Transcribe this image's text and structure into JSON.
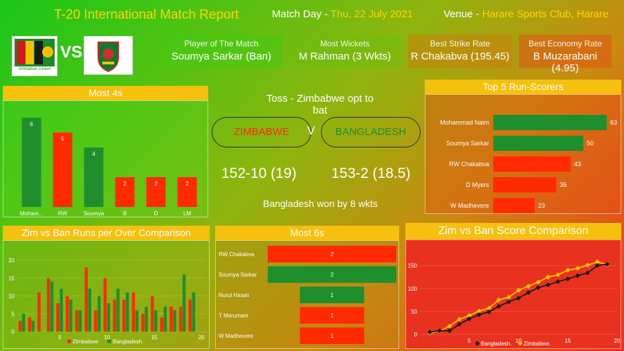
{
  "header": {
    "title": "T-20 International Match Report",
    "match_day_label": "Match Day - ",
    "match_day_value": "Thu, 22 July 2021",
    "venue_label": "Venue - ",
    "venue_value": "Harare Sports Club, Harare"
  },
  "logos": {
    "zimbabwe_caption": "zimbabwe cricket",
    "vs": "VS"
  },
  "kpis": [
    {
      "label": "Player of The Match",
      "value": "Soumya Sarkar (Ban)"
    },
    {
      "label": "Most Wickets",
      "value": "M Rahman (3 Wkts)"
    },
    {
      "label": "Best Strike Rate",
      "value": "R Chakabva (195.45)"
    },
    {
      "label": "Best Economy Rate",
      "value": "B Muzarabani (4.95)"
    }
  ],
  "center": {
    "toss": "Toss - Zimbabwe opt to bat",
    "team1": "ZIMBABWE",
    "team2": "BANGLADESH",
    "v": "V",
    "score1": "152-10 (19)",
    "score2": "153-2 (18.5)",
    "result": "Bangladesh won by 8 wkts"
  },
  "colors": {
    "zim": "#ff2a00",
    "ban": "#1f8f2e",
    "accent": "#f6c00f",
    "line_ban": "#1a1a1a",
    "line_zim": "#ffc000"
  },
  "chart_data": [
    {
      "id": "most4s",
      "type": "bar",
      "title": "Most 4s",
      "categories": [
        "Moham... Naim",
        "RW Chakabva",
        "Soumya Sarkar",
        "B Muzarab...",
        "D Myers",
        "LM Jongwe"
      ],
      "values": [
        6,
        5,
        4,
        2,
        2,
        2
      ],
      "teams": [
        "ban",
        "zim",
        "ban",
        "zim",
        "zim",
        "zim"
      ],
      "ylim": [
        0,
        6
      ]
    },
    {
      "id": "top5",
      "type": "bar",
      "orientation": "horizontal",
      "title": "Top 5 Run-Scorers",
      "categories": [
        "Mohammad Naim",
        "Soumya Sarkar",
        "RW Chakabva",
        "D Myers",
        "W Madhevere"
      ],
      "values": [
        63,
        50,
        43,
        35,
        23
      ],
      "teams": [
        "ban",
        "ban",
        "zim",
        "zim",
        "zim"
      ],
      "xlim": [
        0,
        63
      ]
    },
    {
      "id": "runsPerOver",
      "type": "bar",
      "title": "Zim vs Ban Runs per Over Comparison",
      "x": [
        1,
        2,
        3,
        4,
        5,
        6,
        7,
        8,
        9,
        10,
        11,
        12,
        13,
        14,
        15,
        16,
        17,
        18,
        19,
        20
      ],
      "series": [
        {
          "name": "Zimbabwe",
          "team": "zim",
          "values": [
            3,
            4,
            11,
            15,
            8,
            10,
            6,
            18,
            6,
            15,
            9,
            9,
            11,
            5,
            10,
            4,
            7,
            7,
            9,
            0
          ]
        },
        {
          "name": "Bangladesh",
          "team": "ban",
          "values": [
            5,
            3,
            0,
            14,
            12,
            9,
            6,
            12,
            10,
            8,
            12,
            11,
            6,
            7,
            6,
            7,
            6,
            16,
            11,
            0
          ]
        }
      ],
      "yticks": [
        0,
        5,
        10,
        15,
        20
      ],
      "xticks": [
        5,
        10,
        15,
        20
      ],
      "ylim": [
        0,
        20
      ]
    },
    {
      "id": "most6s",
      "type": "bar",
      "orientation": "horizontal",
      "title": "Most 6s",
      "categories": [
        "RW Chakabva",
        "Soumya Sarkar",
        "Nurul Hasan",
        "T Marumani",
        "W Madhevere"
      ],
      "values": [
        2,
        2,
        1,
        1,
        1
      ],
      "teams": [
        "zim",
        "ban",
        "ban",
        "zim",
        "zim"
      ],
      "xlim": [
        0,
        2
      ]
    },
    {
      "id": "scoreComparison",
      "type": "line",
      "title": "Zim vs Ban Score Comparison",
      "x": [
        1,
        2,
        3,
        4,
        5,
        6,
        7,
        8,
        9,
        10,
        11,
        12,
        13,
        14,
        15,
        16,
        17,
        18,
        19
      ],
      "series": [
        {
          "name": "Bangladesh.",
          "team": "ban",
          "values": [
            5,
            8,
            8,
            22,
            34,
            43,
            49,
            61,
            71,
            79,
            91,
            102,
            108,
            115,
            121,
            128,
            134,
            150,
            153
          ]
        },
        {
          "name": "Zimbabwe.",
          "team": "zim",
          "values": [
            3,
            7,
            18,
            33,
            41,
            51,
            57,
            75,
            81,
            96,
            105,
            114,
            125,
            130,
            140,
            144,
            151,
            158,
            152
          ]
        }
      ],
      "yticks": [
        0,
        50,
        100,
        150
      ],
      "xticks": [
        5,
        10,
        15,
        20
      ],
      "ylim": [
        0,
        160
      ],
      "xlim": [
        0,
        20
      ]
    }
  ]
}
